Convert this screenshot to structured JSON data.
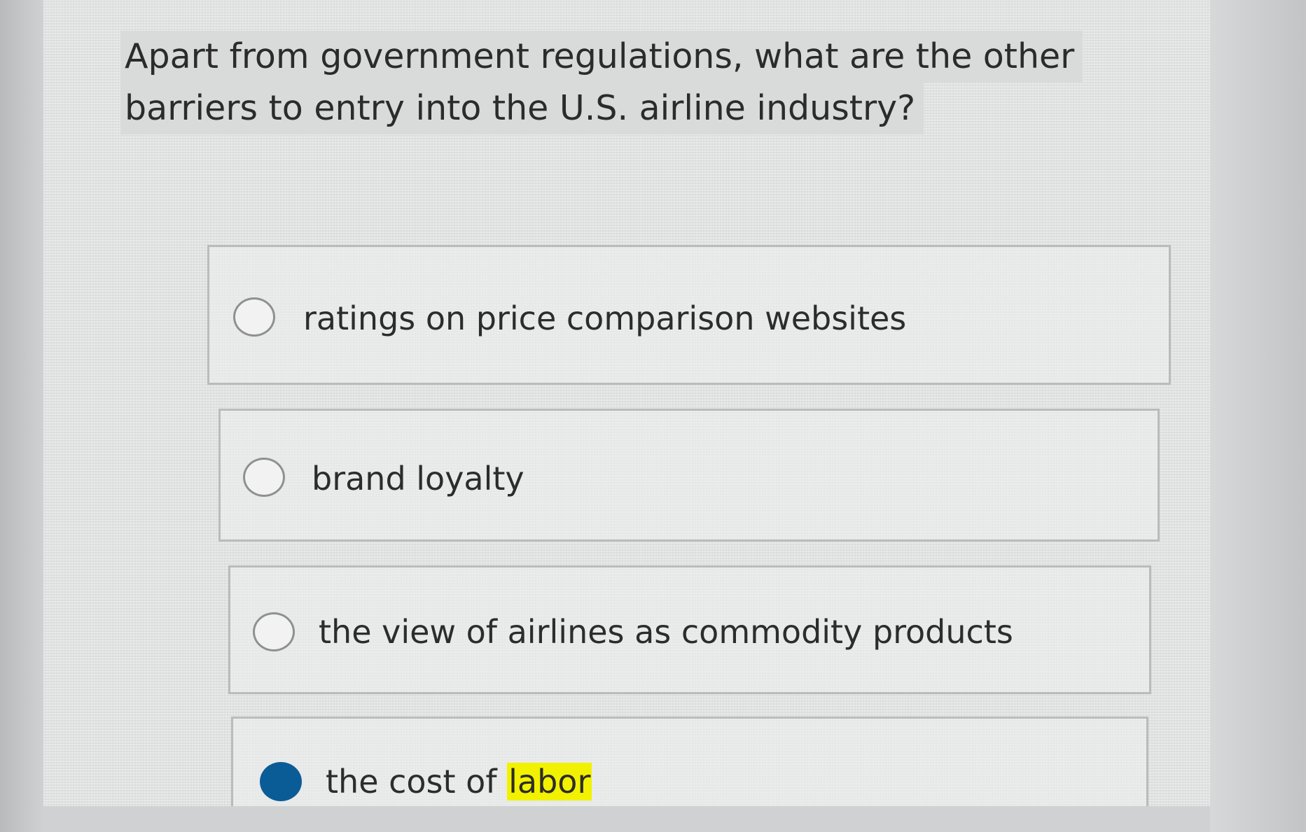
{
  "question": {
    "line1": "Apart from government regulations, what are the other",
    "line2": "barriers to entry into the U.S. airline industry?"
  },
  "options": [
    {
      "label": "ratings on price comparison websites",
      "selected": false
    },
    {
      "label": "brand loyalty",
      "selected": false
    },
    {
      "label": "the view of airlines as commodity products",
      "selected": false
    },
    {
      "label_prefix": "the cost of ",
      "label_highlight": "labor",
      "selected": true
    }
  ],
  "colors": {
    "selected_radio": "#0a5c96",
    "highlight": "#f2f200",
    "text": "#2b2b2b",
    "option_border": "#b9bbbc"
  }
}
